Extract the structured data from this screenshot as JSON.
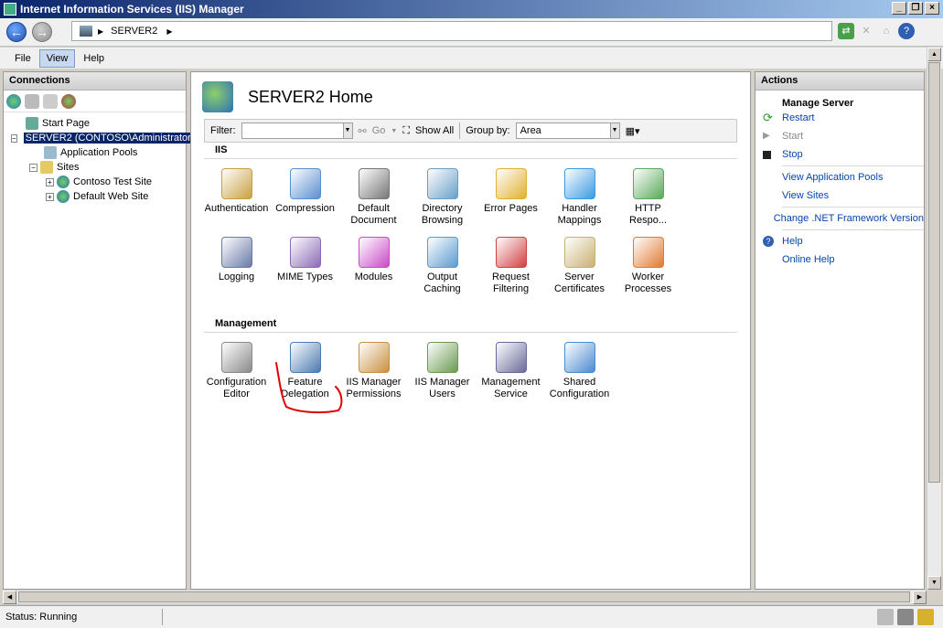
{
  "window": {
    "title": "Internet Information Services (IIS) Manager"
  },
  "address": {
    "segment": "SERVER2"
  },
  "menu": {
    "file": "File",
    "view": "View",
    "help": "Help"
  },
  "connections": {
    "header": "Connections",
    "tree": {
      "start_page": "Start Page",
      "server": "SERVER2 (CONTOSO\\Administrator)",
      "app_pools": "Application Pools",
      "sites": "Sites",
      "site1": "Contoso Test Site",
      "site2": "Default Web Site"
    }
  },
  "main": {
    "title": "SERVER2 Home",
    "filter_label": "Filter:",
    "go_label": "Go",
    "show_all_label": "Show All",
    "group_by_label": "Group by:",
    "group_by_value": "Area",
    "iis_section": "IIS",
    "management_section": "Management",
    "iis_features": [
      {
        "l1": "Authentication",
        "l2": ""
      },
      {
        "l1": "Compression",
        "l2": ""
      },
      {
        "l1": "Default",
        "l2": "Document"
      },
      {
        "l1": "Directory",
        "l2": "Browsing"
      },
      {
        "l1": "Error Pages",
        "l2": ""
      },
      {
        "l1": "Handler",
        "l2": "Mappings"
      },
      {
        "l1": "HTTP",
        "l2": "Respo..."
      },
      {
        "l1": "Logging",
        "l2": ""
      },
      {
        "l1": "MIME Types",
        "l2": ""
      },
      {
        "l1": "Modules",
        "l2": ""
      },
      {
        "l1": "Output",
        "l2": "Caching"
      },
      {
        "l1": "Request",
        "l2": "Filtering"
      },
      {
        "l1": "Server",
        "l2": "Certificates"
      },
      {
        "l1": "Worker",
        "l2": "Processes"
      }
    ],
    "management_features": [
      {
        "l1": "Configuration",
        "l2": "Editor"
      },
      {
        "l1": "Feature",
        "l2": "Delegation"
      },
      {
        "l1": "IIS Manager",
        "l2": "Permissions"
      },
      {
        "l1": "IIS Manager",
        "l2": "Users"
      },
      {
        "l1": "Management",
        "l2": "Service"
      },
      {
        "l1": "Shared",
        "l2": "Configuration"
      }
    ]
  },
  "actions": {
    "header": "Actions",
    "group": "Manage Server",
    "restart": "Restart",
    "start": "Start",
    "stop": "Stop",
    "view_app_pools": "View Application Pools",
    "view_sites": "View Sites",
    "change_net": "Change .NET Framework Version",
    "help": "Help",
    "online_help": "Online Help"
  },
  "status": {
    "text": "Status: Running"
  },
  "colors": {
    "title_bar": "#0a246a",
    "selection": "#0a246a",
    "link": "#0645ad",
    "annotation": "#e00000"
  }
}
